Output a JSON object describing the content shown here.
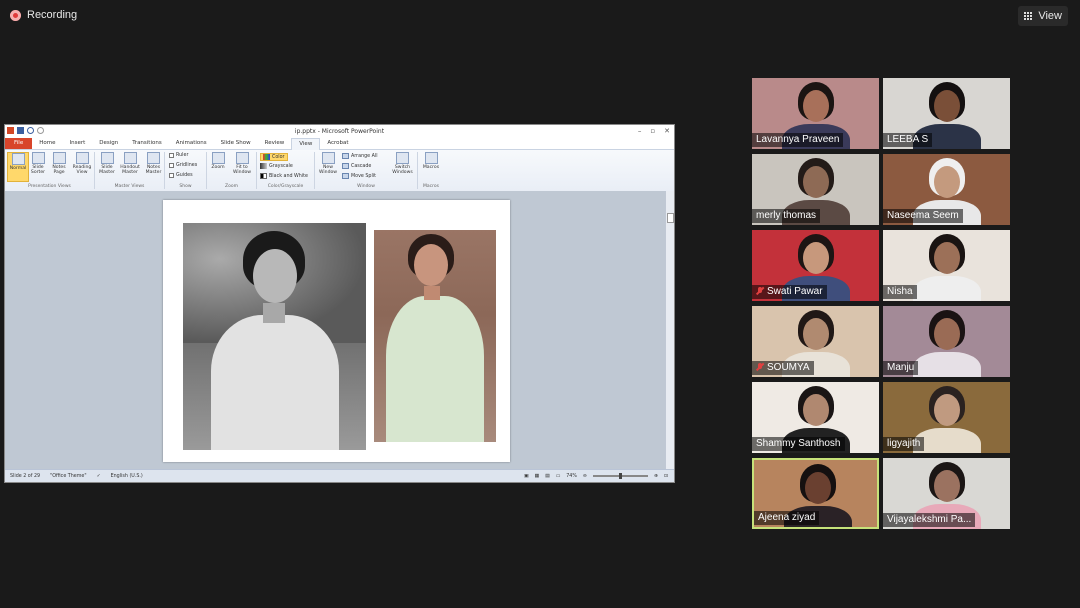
{
  "meeting": {
    "recording_label": "Recording",
    "view_label": "View"
  },
  "powerpoint": {
    "window_title": "ip.pptx - Microsoft PowerPoint",
    "tabs": [
      "File",
      "Home",
      "Insert",
      "Design",
      "Transitions",
      "Animations",
      "Slide Show",
      "Review",
      "View",
      "Acrobat"
    ],
    "active_tab": "View",
    "ribbon": {
      "presentation_views": {
        "group_label": "Presentation Views",
        "buttons": [
          "Normal",
          "Slide Sorter",
          "Notes Page",
          "Reading View"
        ]
      },
      "master_views": {
        "group_label": "Master Views",
        "buttons": [
          "Slide Master",
          "Handout Master",
          "Notes Master"
        ]
      },
      "show": {
        "group_label": "Show",
        "checkboxes": [
          "Ruler",
          "Gridlines",
          "Guides"
        ]
      },
      "zoom": {
        "group_label": "Zoom",
        "buttons": [
          "Zoom",
          "Fit to Window"
        ]
      },
      "color_grayscale": {
        "group_label": "Color/Grayscale",
        "options": [
          "Color",
          "Grayscale",
          "Black and White"
        ]
      },
      "window": {
        "group_label": "Window",
        "new_window": "New Window",
        "options": [
          "Arrange All",
          "Cascade",
          "Move Split"
        ],
        "switch_windows": "Switch Windows"
      },
      "macros": {
        "group_label": "Macros",
        "button": "Macros"
      }
    },
    "status": {
      "slide": "Slide 2 of 29",
      "theme": "\"Office Theme\"",
      "language": "English (U.S.)",
      "zoom": "74%"
    }
  },
  "participants": [
    {
      "name": "Lavannya Praveen",
      "muted": false,
      "speaking": false,
      "bg": "#b98a8a",
      "skin": "#a8705a",
      "hair": "#1b1412",
      "shirt": "#3a3a5a"
    },
    {
      "name": "LEEBA S",
      "muted": false,
      "speaking": false,
      "bg": "#d8d6d2",
      "skin": "#7a4f38",
      "hair": "#141010",
      "shirt": "#2b3347"
    },
    {
      "name": "merly thomas",
      "muted": false,
      "speaking": false,
      "bg": "#c9c5be",
      "skin": "#8e6a55",
      "hair": "#231b18",
      "shirt": "#5b4a44"
    },
    {
      "name": "Naseema Seem",
      "muted": false,
      "speaking": false,
      "bg": "#8c5a40",
      "skin": "#c49a7e",
      "hair": "#efefef",
      "shirt": "#e8e8e8"
    },
    {
      "name": "Swati Pawar",
      "muted": true,
      "speaking": false,
      "bg": "#c3313a",
      "skin": "#c7987c",
      "hair": "#1d1514",
      "shirt": "#3f4e7c"
    },
    {
      "name": "Nisha",
      "muted": false,
      "speaking": false,
      "bg": "#e9e3dc",
      "skin": "#9c7058",
      "hair": "#1a1412",
      "shirt": "#eeeeee"
    },
    {
      "name": "SOUMYA",
      "muted": true,
      "speaking": false,
      "bg": "#d9c4ad",
      "skin": "#b08a70",
      "hair": "#201816",
      "shirt": "#e8e2d8"
    },
    {
      "name": "Manju",
      "muted": false,
      "speaking": false,
      "bg": "#a38a97",
      "skin": "#9a6b55",
      "hair": "#1a1313",
      "shirt": "#e6e0e6"
    },
    {
      "name": "Shammy Santhosh",
      "muted": false,
      "speaking": false,
      "bg": "#efeae4",
      "skin": "#b08870",
      "hair": "#1a1515",
      "shirt": "#222"
    },
    {
      "name": "ligyajith",
      "muted": false,
      "speaking": false,
      "bg": "#8a6a3c",
      "skin": "#c09a80",
      "hair": "#2a2220",
      "shirt": "#e6dccb"
    },
    {
      "name": "Ajeena ziyad",
      "muted": false,
      "speaking": true,
      "bg": "#b7845e",
      "skin": "#6a4030",
      "hair": "#151010",
      "shirt": "#2a2226"
    },
    {
      "name": "Vijayalekshmi Pa...",
      "muted": false,
      "speaking": false,
      "bg": "#d9d8d4",
      "skin": "#9b7260",
      "hair": "#1b1615",
      "shirt": "#e8a9b9"
    }
  ]
}
